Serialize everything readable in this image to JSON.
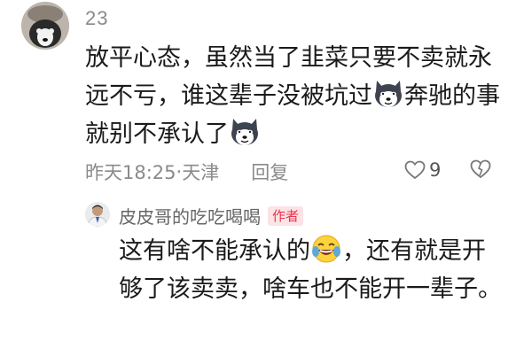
{
  "main_comment": {
    "username": "23",
    "text_part1": "放平心态，虽然当了韭菜只要不卖就永远不亏，谁这辈子没被坑过",
    "text_part2": "奔驰的事就别不承认了",
    "emoji_icon": "husky-dog-emoji",
    "time": "昨天18:25",
    "separator": " · ",
    "location": "天津",
    "reply_label": "回复",
    "like_count": "9"
  },
  "reply": {
    "username": "皮皮哥的吃吃喝喝",
    "badge": "作者",
    "text_part1": "这有啥不能承认的",
    "emoji_icon": "laughing-crying-emoji",
    "text_part2": "，还有就是开够了该卖卖，啥车也不能开一辈子。"
  },
  "colors": {
    "badge_bg": "#fce3e6",
    "badge_text": "#e8344b",
    "meta_text": "#8a8a8a"
  }
}
